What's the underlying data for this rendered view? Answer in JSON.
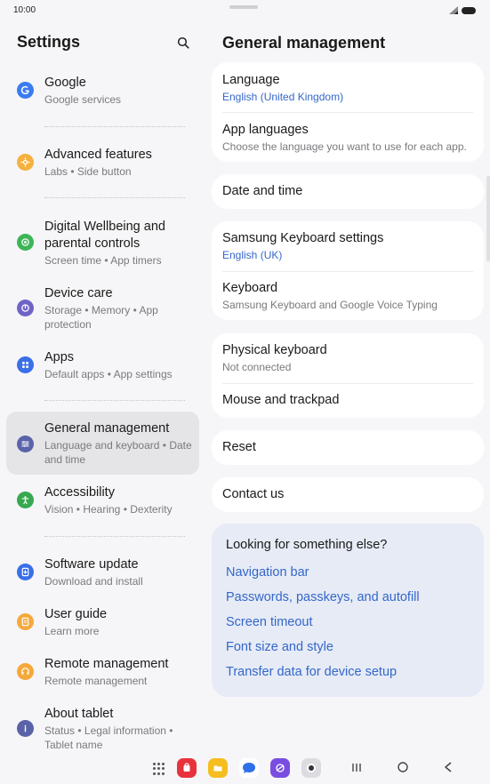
{
  "status": {
    "time": "10:00"
  },
  "left": {
    "title": "Settings",
    "items": [
      {
        "label": "Google",
        "sub": "Google services",
        "icon": "google-icon",
        "color": "#3a7bf0"
      },
      {
        "label": "Advanced features",
        "sub": "Labs • Side button",
        "icon": "advanced-features-icon",
        "color": "#f5b13d"
      },
      {
        "label": "Digital Wellbeing and parental controls",
        "sub": "Screen time • App timers",
        "icon": "digital-wellbeing-icon",
        "color": "#3cb556"
      },
      {
        "label": "Device care",
        "sub": "Storage • Memory • App protection",
        "icon": "device-care-icon",
        "color": "#6f63c7"
      },
      {
        "label": "Apps",
        "sub": "Default apps • App settings",
        "icon": "apps-icon",
        "color": "#3a6fe8"
      },
      {
        "label": "General management",
        "sub": "Language and keyboard • Date and time",
        "icon": "general-management-icon",
        "color": "#5a62a8"
      },
      {
        "label": "Accessibility",
        "sub": "Vision • Hearing • Dexterity",
        "icon": "accessibility-icon",
        "color": "#37a84f"
      },
      {
        "label": "Software update",
        "sub": "Download and install",
        "icon": "software-update-icon",
        "color": "#3a6fe8"
      },
      {
        "label": "User guide",
        "sub": "Learn more",
        "icon": "user-guide-icon",
        "color": "#f5a93a"
      },
      {
        "label": "Remote management",
        "sub": "Remote management",
        "icon": "remote-management-icon",
        "color": "#f5a93a"
      },
      {
        "label": "About tablet",
        "sub": "Status • Legal information • Tablet name",
        "icon": "info-icon",
        "color": "#5a62a8"
      }
    ]
  },
  "right": {
    "title": "General management",
    "language": {
      "label": "Language",
      "sub": "English (United Kingdom)"
    },
    "app_languages": {
      "label": "App languages",
      "sub": "Choose the language you want to use for each app."
    },
    "date_time": {
      "label": "Date and time"
    },
    "samsung_keyboard": {
      "label": "Samsung Keyboard settings",
      "sub": "English (UK)"
    },
    "keyboard": {
      "label": "Keyboard",
      "sub": "Samsung Keyboard and Google Voice Typing"
    },
    "physical_keyboard": {
      "label": "Physical keyboard",
      "sub": "Not connected"
    },
    "mouse": {
      "label": "Mouse and trackpad"
    },
    "reset": {
      "label": "Reset"
    },
    "contact": {
      "label": "Contact us"
    },
    "suggestions": {
      "title": "Looking for something else?",
      "links": [
        "Navigation bar",
        "Passwords, passkeys, and autofill",
        "Screen timeout",
        "Font size and style",
        "Transfer data for device setup"
      ]
    }
  },
  "colors": {
    "accent": "#3467c9",
    "active_item": "#e5e5e8",
    "background": "#f6f6f8"
  }
}
